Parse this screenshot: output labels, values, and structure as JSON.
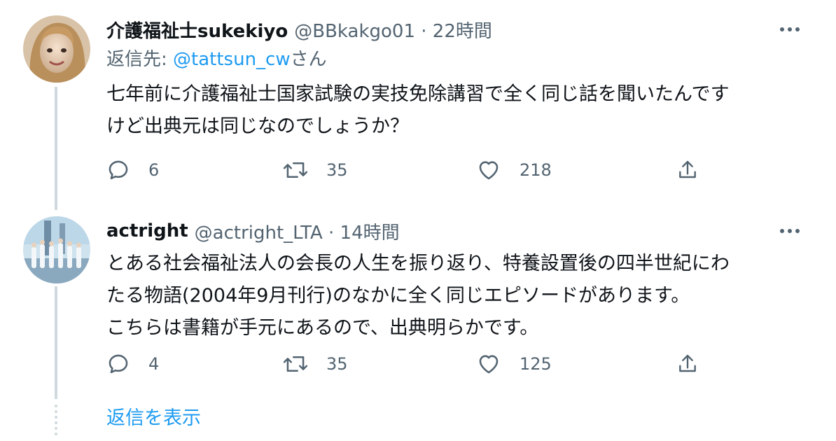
{
  "tweets": [
    {
      "display_name": "介護福祉士sukekiyo",
      "meta": "@BBkakgo01 · 22時間",
      "reply_prefix": "返信先: ",
      "reply_handle": "@tattsun_cw",
      "reply_suffix": "さん",
      "text": "七年前に介護福祉士国家試験の実技免除講習で全く同じ話を聞いたんです\nけど出典元は同じなのでしょうか？",
      "replies": "6",
      "retweets": "35",
      "likes": "218"
    },
    {
      "display_name": "actright",
      "meta": "@actright_LTA · 14時間",
      "text": "とある社会福祉法人の会長の人生を振り返り、特養設置後の四半世紀にわ\nたる物語(2004年9月刊行)のなかに全く同じエピソードがあります。\nこちらは書籍が手元にあるので、出典明らかです。",
      "replies": "4",
      "retweets": "35",
      "likes": "125"
    }
  ],
  "show_replies_label": "返信を表示",
  "icons": {
    "more": "more-horizontal-icon",
    "reply": "reply-bubble-icon",
    "retweet": "retweet-icon",
    "like": "heart-icon",
    "share": "share-icon"
  },
  "colors": {
    "link": "#1d9bf0",
    "secondary_text": "#536471",
    "primary_text": "#0f1419",
    "thread_line": "#cfd9de"
  }
}
